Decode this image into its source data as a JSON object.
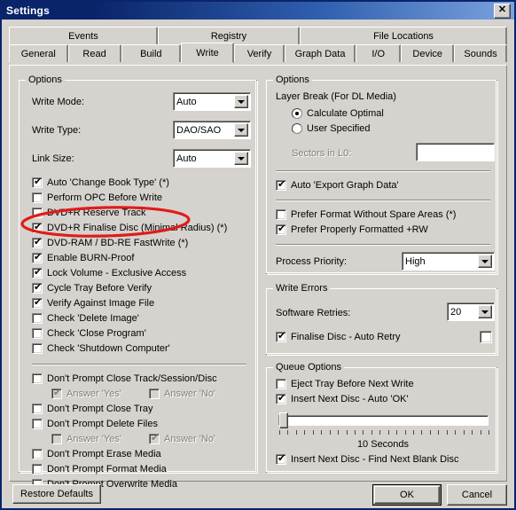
{
  "window": {
    "title": "Settings",
    "close_label": "✕"
  },
  "tabs": {
    "row1": [
      {
        "label": "Events",
        "selected": false
      },
      {
        "label": "Registry",
        "selected": false
      },
      {
        "label": "File Locations",
        "selected": false
      }
    ],
    "row2": [
      {
        "label": "General",
        "selected": false
      },
      {
        "label": "Read",
        "selected": false
      },
      {
        "label": "Build",
        "selected": false
      },
      {
        "label": "Write",
        "selected": true
      },
      {
        "label": "Verify",
        "selected": false
      },
      {
        "label": "Graph Data",
        "selected": false
      },
      {
        "label": "I/O",
        "selected": false
      },
      {
        "label": "Device",
        "selected": false
      },
      {
        "label": "Sounds",
        "selected": false
      }
    ]
  },
  "left_panel": {
    "group_title": "Options",
    "fields": [
      {
        "label": "Write Mode:",
        "value": "Auto"
      },
      {
        "label": "Write Type:",
        "value": "DAO/SAO"
      },
      {
        "label": "Link Size:",
        "value": "Auto"
      }
    ],
    "checks_group_a": [
      {
        "label": "Auto 'Change Book Type' (*)",
        "checked": true,
        "disabled": false
      },
      {
        "label": "Perform OPC Before Write",
        "checked": false,
        "disabled": false
      },
      {
        "label": "DVD+R Reserve Track",
        "checked": false,
        "disabled": false
      },
      {
        "label": "DVD+R Finalise Disc (Minimal Radius) (*)",
        "checked": true,
        "disabled": false
      },
      {
        "label": "DVD-RAM / BD-RE FastWrite (*)",
        "checked": true,
        "disabled": false
      },
      {
        "label": "Enable BURN-Proof",
        "checked": true,
        "disabled": false
      },
      {
        "label": "Lock Volume - Exclusive Access",
        "checked": true,
        "disabled": false
      },
      {
        "label": "Cycle Tray Before Verify",
        "checked": true,
        "disabled": false
      },
      {
        "label": "Verify Against Image File",
        "checked": true,
        "disabled": false
      },
      {
        "label": "Check 'Delete Image'",
        "checked": false,
        "disabled": false
      },
      {
        "label": "Check 'Close Program'",
        "checked": false,
        "disabled": false
      },
      {
        "label": "Check 'Shutdown Computer'",
        "checked": false,
        "disabled": false
      }
    ],
    "checks_group_b": [
      {
        "label": "Don't Prompt Close Track/Session/Disc",
        "checked": false,
        "disabled": false
      },
      {
        "label": "Don't Prompt Close Tray",
        "checked": false,
        "disabled": false
      },
      {
        "label": "Don't Prompt Delete Files",
        "checked": false,
        "disabled": false
      },
      {
        "label": "Don't Prompt Erase Media",
        "checked": false,
        "disabled": false
      },
      {
        "label": "Don't Prompt Format Media",
        "checked": false,
        "disabled": false
      },
      {
        "label": "Don't Prompt Overwrite Media",
        "checked": false,
        "disabled": false
      }
    ],
    "answer_row_1": [
      {
        "label": "Answer 'Yes'",
        "checked": true,
        "disabled": true
      },
      {
        "label": "Answer 'No'",
        "checked": false,
        "disabled": true
      }
    ],
    "answer_row_2": [
      {
        "label": "Answer 'Yes'",
        "checked": false,
        "disabled": true
      },
      {
        "label": "Answer 'No'",
        "checked": true,
        "disabled": true
      }
    ]
  },
  "right_panel": {
    "group_title": "Options",
    "layer_break_label": "Layer Break (For DL Media)",
    "radios": [
      {
        "label": "Calculate Optimal",
        "selected": true
      },
      {
        "label": "User Specified",
        "selected": false
      }
    ],
    "sectors_label": "Sectors in L0:",
    "sectors_value": "",
    "auto_export": {
      "label": "Auto 'Export Graph Data'",
      "checked": true
    },
    "prefer": [
      {
        "label": "Prefer Format Without Spare Areas (*)",
        "checked": false
      },
      {
        "label": "Prefer Properly Formatted +RW",
        "checked": true
      }
    ],
    "process_priority": {
      "label": "Process Priority:",
      "value": "High"
    },
    "write_errors": {
      "group_title": "Write Errors",
      "retries_label": "Software Retries:",
      "retries_value": "20",
      "finalise": {
        "label": "Finalise Disc - Auto Retry",
        "checked": true
      },
      "extra_checkbox_checked": false
    },
    "queue_options": {
      "group_title": "Queue Options",
      "eject": {
        "label": "Eject Tray Before Next Write",
        "checked": false
      },
      "insert_auto_ok": {
        "label": "Insert Next Disc - Auto 'OK'",
        "checked": true
      },
      "slider_value_label": "10 Seconds",
      "slider_position_percent": 4,
      "slider_tick_count": 26,
      "find_blank": {
        "label": "Insert Next Disc - Find Next Blank Disc",
        "checked": true
      }
    }
  },
  "footer": {
    "restore_defaults": "Restore Defaults",
    "ok": "OK",
    "cancel": "Cancel"
  },
  "annotation": {
    "shape": "ellipse",
    "color": "#e01b1b",
    "targets": "DVD-RAM / BD-RE FastWrite (*)"
  }
}
